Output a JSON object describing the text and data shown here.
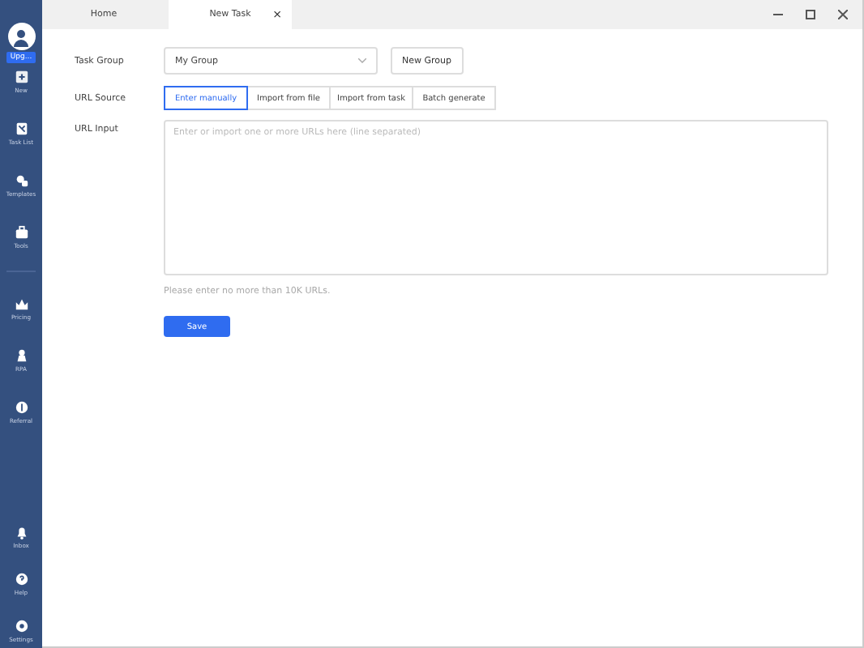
{
  "sidebar": {
    "badge": "Upg...",
    "items": [
      {
        "label": "New"
      },
      {
        "label": "Task List"
      },
      {
        "label": "Templates"
      },
      {
        "label": "Tools"
      }
    ],
    "middle_items": [
      {
        "label": "Pricing"
      },
      {
        "label": "RPA"
      },
      {
        "label": "Referral"
      }
    ],
    "bottom_items": [
      {
        "label": "Inbox"
      },
      {
        "label": "Help"
      },
      {
        "label": "Settings"
      }
    ]
  },
  "tabs": [
    {
      "label": "Home",
      "selected": false
    },
    {
      "label": "New Task",
      "selected": true,
      "close": "×"
    }
  ],
  "form": {
    "task_group": {
      "label": "Task Group",
      "value": "My Group",
      "button": "New Group"
    },
    "url_source": {
      "label": "URL Source",
      "options": [
        {
          "label": "Enter manually",
          "selected": true
        },
        {
          "label": "Import from file",
          "selected": false
        },
        {
          "label": "Import from task",
          "selected": false
        },
        {
          "label": "Batch generate",
          "selected": false
        }
      ]
    },
    "url_input": {
      "label": "URL Input",
      "placeholder": "Enter or import one or more URLs here (line separated)"
    },
    "hint": "Please enter no more than 10K URLs.",
    "save": "Save"
  }
}
